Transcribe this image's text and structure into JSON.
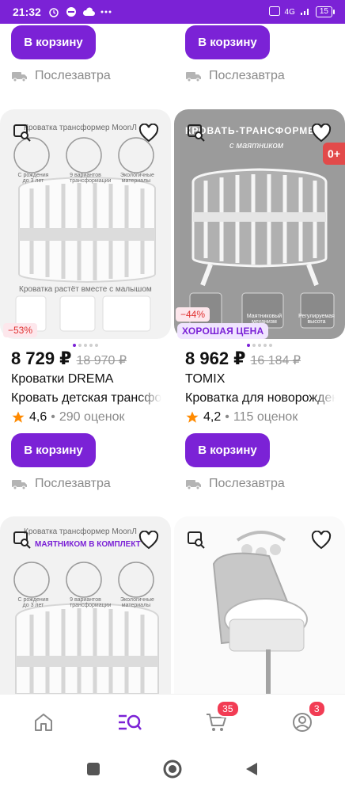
{
  "status_bar": {
    "time": "21:32",
    "network": "4G",
    "battery": "15"
  },
  "colors": {
    "brand": "#7b22d6",
    "discount": "#e0302f",
    "badge": "#f23c54"
  },
  "top_row": {
    "left": {
      "cart_label": "В корзину",
      "delivery": "Послезавтра"
    },
    "right": {
      "cart_label": "В корзину",
      "delivery": "Послезавтра"
    }
  },
  "products": [
    {
      "discount": "−53%",
      "badge": "",
      "price": "8 729 ₽",
      "old_price": "18 970 ₽",
      "brand": "Кроватки DREMA",
      "title": "Кровать детская трансформер",
      "rating": "4,6",
      "reviews": "290 оценок",
      "cart_label": "В корзину",
      "delivery": "Послезавтра",
      "image_texts": {
        "top": "Кроватка трансформер MoonЛ",
        "f1": "С рождения до 3 лет",
        "f2": "9 вариантов трансформации",
        "f3": "Экологичные материалы",
        "bottom": "Кроватка растёт вместе с малышом"
      }
    },
    {
      "discount": "−44%",
      "badge": "ХОРОШАЯ ЦЕНА",
      "price": "8 962 ₽",
      "old_price": "16 184 ₽",
      "brand": "TOMIX",
      "title": "Кроватка для новорожденных",
      "rating": "4,2",
      "reviews": "115 оценок",
      "cart_label": "В корзину",
      "delivery": "Послезавтра",
      "image_texts": {
        "title1": "КРОВАТЬ-ТРАНСФОРМЕР",
        "title2": "с маятником",
        "age": "0+",
        "f1": "Маятниковый механизм",
        "f2": "Регулируемая высота"
      }
    },
    {
      "image_texts": {
        "top": "Кроватка трансформер MoonЛ",
        "sub": "МАЯТНИКОМ В КОМПЛЕКТ",
        "f1": "С рождения до 3 лет",
        "f2": "9 вариантов трансформации",
        "f3": "Экологичные материалы"
      }
    },
    {
      "image_texts": {}
    }
  ],
  "bottom_nav": {
    "cart_count": "35",
    "profile_count": "3"
  }
}
